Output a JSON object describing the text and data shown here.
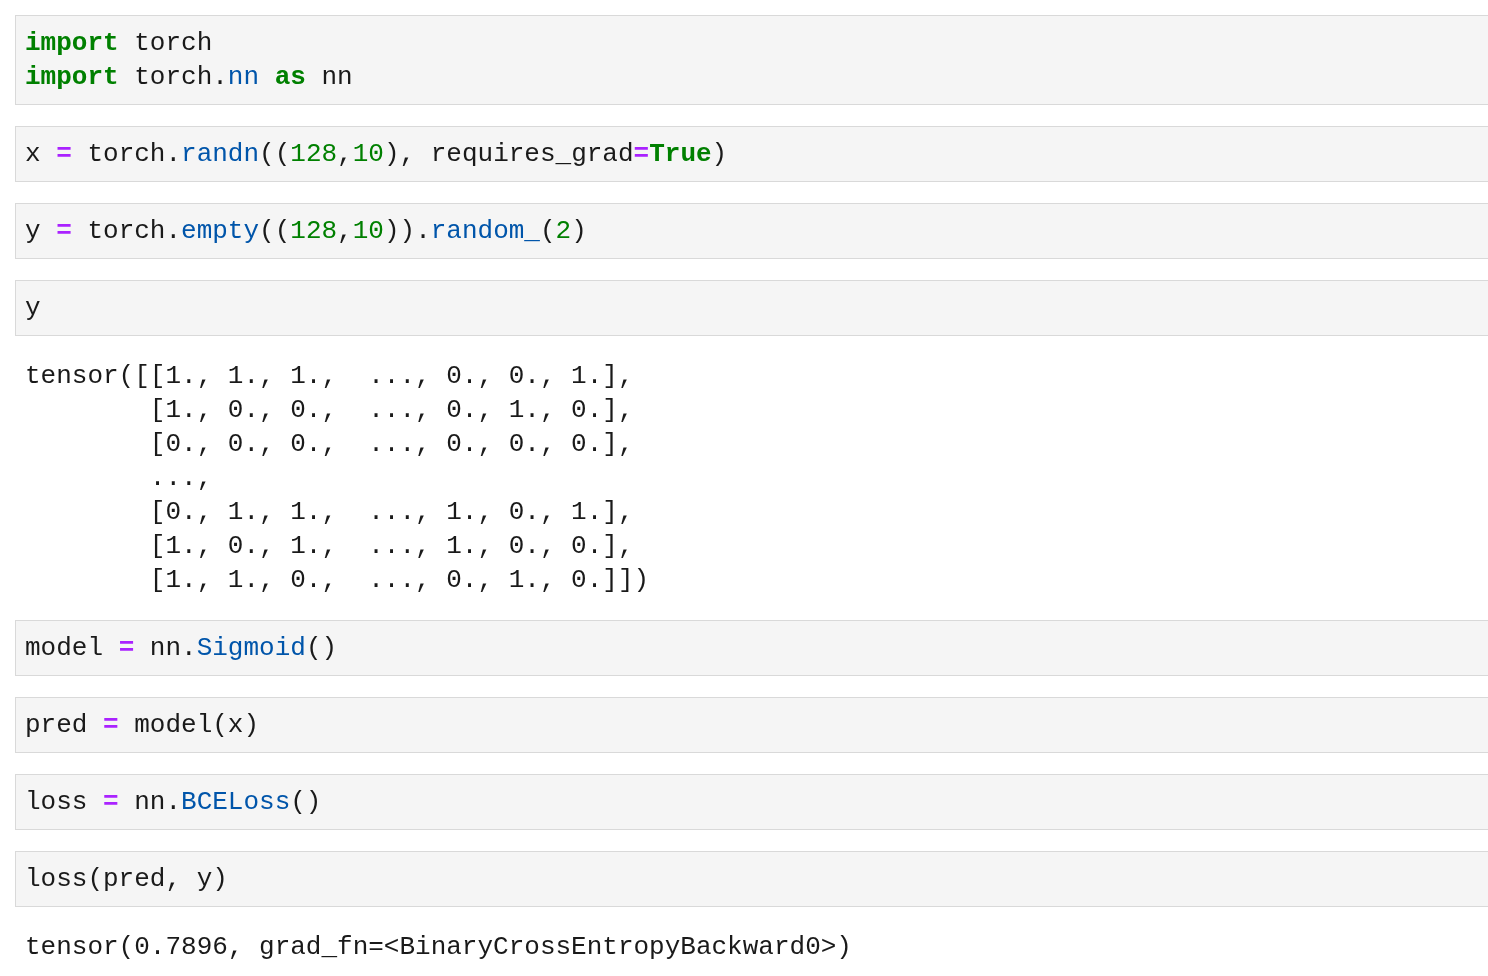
{
  "cells": [
    {
      "kind": "code",
      "lines": [
        [
          {
            "kind": "kw",
            "text": "import"
          },
          {
            "kind": "plain",
            "text": " torch"
          }
        ],
        [
          {
            "kind": "kw",
            "text": "import"
          },
          {
            "kind": "plain",
            "text": " torch."
          },
          {
            "kind": "fn",
            "text": "nn"
          },
          {
            "kind": "kw",
            "text": " as"
          },
          {
            "kind": "plain",
            "text": " nn"
          }
        ]
      ]
    },
    {
      "kind": "code",
      "lines": [
        [
          {
            "kind": "plain",
            "text": "x "
          },
          {
            "kind": "op",
            "text": "="
          },
          {
            "kind": "plain",
            "text": " torch."
          },
          {
            "kind": "fn",
            "text": "randn"
          },
          {
            "kind": "plain",
            "text": "(("
          },
          {
            "kind": "num",
            "text": "128"
          },
          {
            "kind": "plain",
            "text": ","
          },
          {
            "kind": "num",
            "text": "10"
          },
          {
            "kind": "plain",
            "text": "), requires_grad"
          },
          {
            "kind": "op",
            "text": "="
          },
          {
            "kind": "kw",
            "text": "True"
          },
          {
            "kind": "plain",
            "text": ")"
          }
        ]
      ]
    },
    {
      "kind": "code",
      "lines": [
        [
          {
            "kind": "plain",
            "text": "y "
          },
          {
            "kind": "op",
            "text": "="
          },
          {
            "kind": "plain",
            "text": " torch."
          },
          {
            "kind": "fn",
            "text": "empty"
          },
          {
            "kind": "plain",
            "text": "(("
          },
          {
            "kind": "num",
            "text": "128"
          },
          {
            "kind": "plain",
            "text": ","
          },
          {
            "kind": "num",
            "text": "10"
          },
          {
            "kind": "plain",
            "text": "))."
          },
          {
            "kind": "fn",
            "text": "random_"
          },
          {
            "kind": "plain",
            "text": "("
          },
          {
            "kind": "num",
            "text": "2"
          },
          {
            "kind": "plain",
            "text": ")"
          }
        ]
      ]
    },
    {
      "kind": "code",
      "lines": [
        [
          {
            "kind": "plain",
            "text": "y"
          }
        ]
      ]
    },
    {
      "kind": "output",
      "lines": [
        "tensor([[1., 1., 1.,  ..., 0., 0., 1.],",
        "        [1., 0., 0.,  ..., 0., 1., 0.],",
        "        [0., 0., 0.,  ..., 0., 0., 0.],",
        "        ...,",
        "        [0., 1., 1.,  ..., 1., 0., 1.],",
        "        [1., 0., 1.,  ..., 1., 0., 0.],",
        "        [1., 1., 0.,  ..., 0., 1., 0.]])"
      ]
    },
    {
      "kind": "code",
      "lines": [
        [
          {
            "kind": "plain",
            "text": "model "
          },
          {
            "kind": "op",
            "text": "="
          },
          {
            "kind": "plain",
            "text": " nn."
          },
          {
            "kind": "fn",
            "text": "Sigmoid"
          },
          {
            "kind": "plain",
            "text": "()"
          }
        ]
      ]
    },
    {
      "kind": "code",
      "lines": [
        [
          {
            "kind": "plain",
            "text": "pred "
          },
          {
            "kind": "op",
            "text": "="
          },
          {
            "kind": "plain",
            "text": " model(x)"
          }
        ]
      ]
    },
    {
      "kind": "code",
      "lines": [
        [
          {
            "kind": "plain",
            "text": "loss "
          },
          {
            "kind": "op",
            "text": "="
          },
          {
            "kind": "plain",
            "text": " nn."
          },
          {
            "kind": "fn",
            "text": "BCELoss"
          },
          {
            "kind": "plain",
            "text": "()"
          }
        ]
      ]
    },
    {
      "kind": "code",
      "lines": [
        [
          {
            "kind": "plain",
            "text": "loss(pred, y)"
          }
        ]
      ]
    },
    {
      "kind": "output",
      "lines": [
        "tensor(0.7896, grad_fn=<BinaryCrossEntropyBackward0>)"
      ]
    }
  ]
}
